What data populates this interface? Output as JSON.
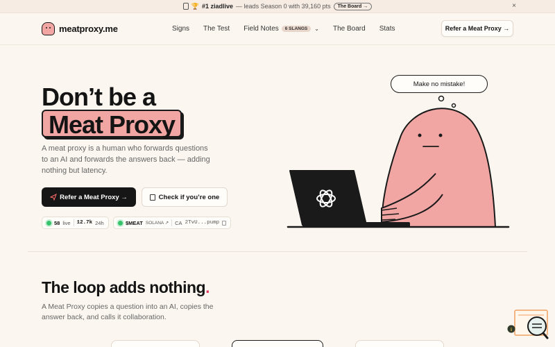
{
  "announcement": {
    "rank": "#1 ziadlive",
    "text": "— leads Season 0 with 39,160 pts",
    "pill": "The Board →",
    "close": "×"
  },
  "nav": {
    "logo": "meatproxy.me",
    "links": [
      "Signs",
      "The Test",
      "Field Notes",
      "The Board",
      "Stats"
    ],
    "field_notes_badge": "6 SLANGS",
    "cta": "Refer a Meat Proxy →"
  },
  "hero": {
    "title_line1": "Don’t be a",
    "title_line2": "Meat Proxy",
    "description": "A meat proxy is a human who forwards questions to an AI and forwards the answers back — adding nothing but latency.",
    "primary_button": "Refer a Meat Proxy →",
    "secondary_button": "Check if you’re one",
    "stats": {
      "live_count": "58",
      "live_label": "live",
      "views": "12.7k",
      "period": "24h"
    },
    "token": {
      "symbol": "$MEAT",
      "chain": "SOLANA ↗",
      "ca_label": "CA",
      "address": "2TvU...pump"
    },
    "speech_bubble": "Make no mistake!"
  },
  "section_loop": {
    "title": "The loop adds nothing",
    "title_dot": ".",
    "description": "A Meat Proxy copies a question into an AI, copies the answer back, and calls it collaboration."
  },
  "colors": {
    "background": "#fbf6ef",
    "accent_pink": "#f2a6a4",
    "dark": "#161616",
    "live_green": "#37c36b",
    "dot_red": "#e23d62"
  }
}
